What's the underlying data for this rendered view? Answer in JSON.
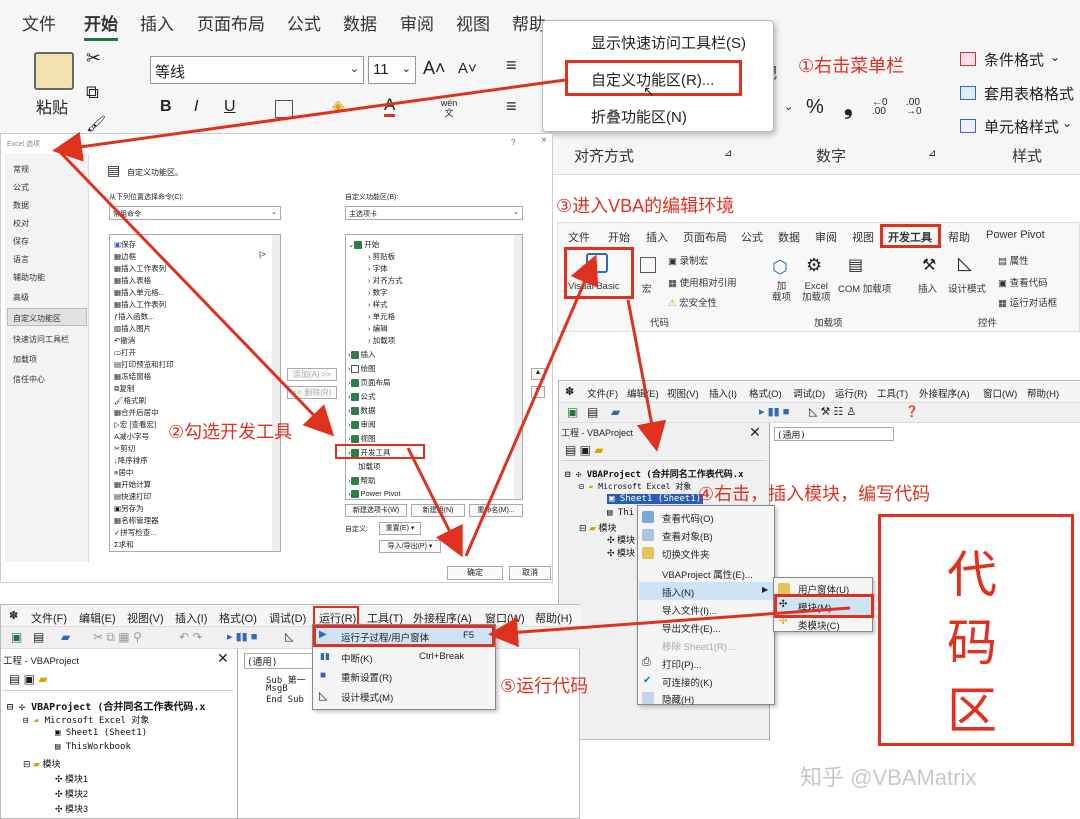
{
  "ribbon": {
    "tabs": [
      "文件",
      "开始",
      "插入",
      "页面布局",
      "公式",
      "数据",
      "审阅",
      "视图",
      "帮助",
      "Power Pivot"
    ],
    "active_tab": "开始",
    "paste_label": "粘贴",
    "font_name": "等线",
    "font_size": "11",
    "bold": "B",
    "italic": "I",
    "underline": "U",
    "wen_label": "wén 文",
    "pct": "%",
    "comma": "❟",
    "align_group": "对齐方式",
    "number_group": "数字",
    "style_group": "样式",
    "view_partial": "视",
    "cond_format": "条件格式",
    "table_format": "套用表格格式",
    "cell_style": "单元格样式"
  },
  "context_menu_1": {
    "items": [
      "显示快速访问工具栏(S)",
      "自定义功能区(R)...",
      "折叠功能区(N)"
    ]
  },
  "annotations": {
    "step1": "①右击菜单栏",
    "step2": "②勾选开发工具",
    "step3": "③进入VBA的编辑环境",
    "step4": "④右击，插入模块，编写代码",
    "step5": "⑤运行代码",
    "code_area": [
      "代",
      "码",
      "区"
    ]
  },
  "options_dialog": {
    "title": "Excel 选项",
    "help": "?",
    "close": "×",
    "nav": [
      "常规",
      "公式",
      "数据",
      "校对",
      "保存",
      "语言",
      "辅助功能",
      "高级",
      "自定义功能区",
      "快速访问工具栏",
      "加载项",
      "信任中心"
    ],
    "header": "自定义功能区。",
    "left_label": "从下列位置选择命令(C):",
    "left_select": "常用命令",
    "right_label": "自定义功能区(B):",
    "right_select": "主选项卡",
    "commands": [
      "保存",
      "边框",
      "插入工作表列",
      "插入表格",
      "插入单元格...",
      "插入工作表列",
      "插入函数...",
      "插入图片",
      "撤消",
      "打开",
      "打印预览和打印",
      "冻结窗格",
      "复制",
      "格式刷",
      "合并后居中",
      "宏 [查看宏]",
      "减小字号",
      "剪切",
      "降序排序",
      "居中",
      "开始计算",
      "快速打印",
      "另存为",
      "名称管理器",
      "拼写检查...",
      "求和"
    ],
    "tree_start": "开始",
    "tree_children": [
      "剪贴板",
      "字体",
      "对齐方式",
      "数字",
      "样式",
      "单元格",
      "编辑",
      "加载项"
    ],
    "tree_tabs": [
      "插入",
      "绘图",
      "页面布局",
      "公式",
      "数据",
      "审阅",
      "视图",
      "开发工具",
      "加载项",
      "帮助",
      "Power Pivot"
    ],
    "add_btn": "添加(A) >>",
    "remove_btn": "<< 删除(R)",
    "new_tab_btn": "新建选项卡(W)",
    "new_group_btn": "新建组(N)",
    "rename_btn": "重命名(M)...",
    "customize_label": "自定义:",
    "reset_btn": "重置(E) ▾",
    "import_export_btn": "导入/导出(P) ▾",
    "ok_btn": "确定",
    "cancel_btn": "取消"
  },
  "dev_ribbon": {
    "tabs": [
      "文件",
      "开始",
      "插入",
      "页面布局",
      "公式",
      "数据",
      "审阅",
      "视图",
      "开发工具",
      "帮助",
      "Power Pivot"
    ],
    "active_tab": "开发工具",
    "visual_basic": "Visual Basic",
    "macro": "宏",
    "record_macro": "录制宏",
    "relative_ref": "使用相对引用",
    "macro_security": "宏安全性",
    "code_group": "代码",
    "addins": "加\n载项",
    "excel_addins": "Excel\n加载项",
    "com_addins": "COM 加载项",
    "addins_group": "加载项",
    "insert": "插入",
    "design_mode": "设计模式",
    "properties": "属性",
    "view_code": "查看代码",
    "run_dialog": "运行对话框",
    "controls_group": "控件"
  },
  "vbe_right": {
    "menus": [
      "文件(F)",
      "编辑(E)",
      "视图(V)",
      "插入(I)",
      "格式(O)",
      "调试(D)",
      "运行(R)",
      "工具(T)",
      "外接程序(A)",
      "窗口(W)",
      "帮助(H)"
    ],
    "project_title": "工程 - VBAProject",
    "code_combo": "(通用)",
    "project_root": "VBAProject (合并同名工作表代码.x",
    "excel_objects": "Microsoft Excel 对象",
    "sheet1": "Sheet1 (Sheet1)",
    "this_wb_partial": "Thi",
    "modules_partial": "模块",
    "mod_partial": "模块"
  },
  "context_menu_2": {
    "items": [
      "查看代码(O)",
      "查看对象(B)",
      "切换文件夹",
      "VBAProject 属性(E)...",
      "插入(N)",
      "导入文件(I)...",
      "导出文件(E)...",
      "移除 Sheet1(R)...",
      "打印(P)...",
      "可连接的(K)",
      "隐藏(H)"
    ],
    "submenu": [
      "用户窗体(U)",
      "模块(M)",
      "类模块(C)"
    ]
  },
  "vbe_left": {
    "menus": [
      "文件(F)",
      "编辑(E)",
      "视图(V)",
      "插入(I)",
      "格式(O)",
      "调试(D)",
      "运行(R)",
      "工具(T)",
      "外接程序(A)",
      "窗口(W)",
      "帮助(H)"
    ],
    "project_title": "工程 - VBAProject",
    "code_combo": "(通用)",
    "code_lines": [
      "Sub 第一",
      "  MsgB",
      "End Sub"
    ],
    "project_root": "VBAProject (合并同名工作表代码.x",
    "excel_objects": "Microsoft Excel 对象",
    "sheet1": "Sheet1 (Sheet1)",
    "this_workbook": "ThisWorkbook",
    "modules": "模块",
    "module_items": [
      "模块1",
      "模块2",
      "模块3"
    ]
  },
  "run_menu": {
    "items": [
      {
        "label": "运行子过程/用户窗体",
        "shortcut": "F5"
      },
      {
        "label": "中断(K)",
        "shortcut": "Ctrl+Break"
      },
      {
        "label": "重新设置(R)",
        "shortcut": ""
      },
      {
        "label": "设计模式(M)",
        "shortcut": ""
      }
    ]
  },
  "watermark": "知乎 @VBAMatrix",
  "colors": {
    "accent_red": "#e0301e",
    "excel_green": "#217346"
  }
}
